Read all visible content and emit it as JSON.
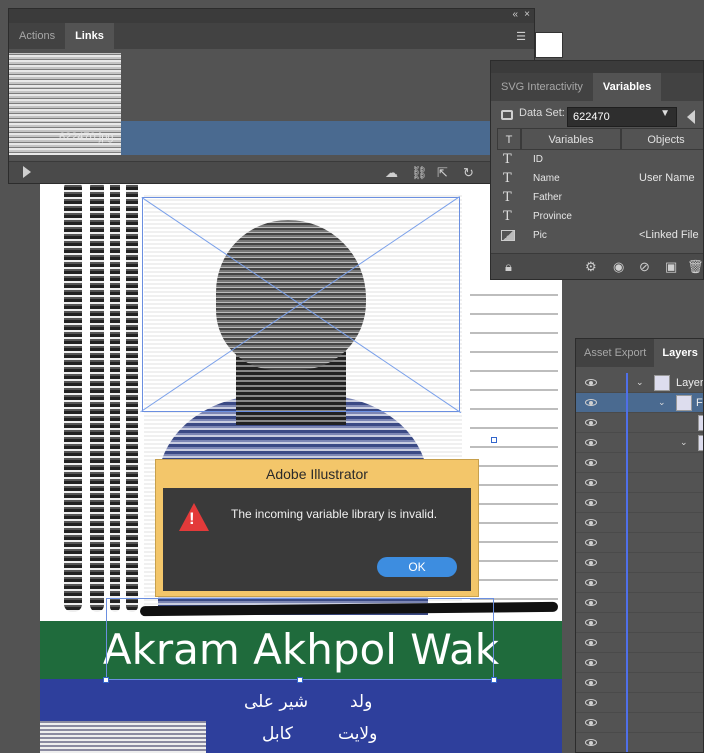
{
  "links_panel": {
    "tabs": [
      {
        "label": "Actions"
      },
      {
        "label": "Links"
      }
    ],
    "active_tab": "Links",
    "rows": [
      {
        "filename": ""
      },
      {
        "filename": ""
      },
      {
        "filename": "622470.jpg"
      }
    ],
    "icons": [
      "play-icon",
      "cloud-link-icon",
      "relink-icon",
      "goto-link-icon",
      "update-link-icon"
    ]
  },
  "variables_panel": {
    "tabs": [
      {
        "label": "SVG Interactivity"
      },
      {
        "label": "Variables"
      }
    ],
    "active_tab": "Variables",
    "dataset_label": "Data Set:",
    "dataset_value": "622470",
    "columns": {
      "type": "T",
      "variables": "Variables",
      "objects": "Objects"
    },
    "rows": [
      {
        "type": "T",
        "name": "ID",
        "object": ""
      },
      {
        "type": "T",
        "name": "Name",
        "object": "User Name"
      },
      {
        "type": "T",
        "name": "Father",
        "object": ""
      },
      {
        "type": "T",
        "name": "Province",
        "object": ""
      },
      {
        "type": "image",
        "name": "Pic",
        "object": "<Linked File"
      }
    ]
  },
  "layers_panel": {
    "tabs": [
      {
        "label": "Asset Export"
      },
      {
        "label": "Layers"
      }
    ],
    "active_tab": "Layers",
    "rows": [
      {
        "name": "Layer",
        "level": 0,
        "selected": false
      },
      {
        "name": "F",
        "level": 1,
        "selected": true
      },
      {
        "name": "",
        "level": 2,
        "selected": false
      },
      {
        "name": "",
        "level": 2,
        "selected": false
      }
    ]
  },
  "artboard": {
    "name_text": "Akram Akhpol Wak",
    "urdu_lines": [
      {
        "left": "شیر علی",
        "right": "ولد"
      },
      {
        "left": "کابل",
        "right": "ولایت"
      }
    ]
  },
  "dialog": {
    "title": "Adobe Illustrator",
    "message": "The incoming variable library is invalid.",
    "ok_label": "OK"
  },
  "colors": {
    "accent": "#3d8de0",
    "dialog_bg": "#f3c66a",
    "green_band": "#1f6b3c",
    "blue_band": "#2e3f9c",
    "selection": "#4a6a90"
  }
}
